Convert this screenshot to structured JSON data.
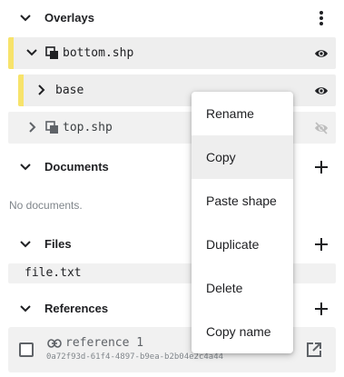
{
  "sections": {
    "overlays": {
      "title": "Overlays"
    },
    "documents": {
      "title": "Documents",
      "empty": "No documents."
    },
    "files": {
      "title": "Files"
    },
    "references": {
      "title": "References"
    }
  },
  "overlays": [
    {
      "label": "bottom.shp",
      "expanded": true,
      "visible": true
    },
    {
      "label": "base",
      "expanded": false,
      "visible": true
    },
    {
      "label": "top.shp",
      "expanded": false,
      "visible": false
    }
  ],
  "files": [
    {
      "label": "file.txt"
    }
  ],
  "references": [
    {
      "name": "reference 1",
      "id": "0a72f93d-61f4-4897-b9ea-b2b04e2c4a44",
      "checked": false
    }
  ],
  "context_menu": {
    "items": [
      "Rename",
      "Copy",
      "Paste shape",
      "Duplicate",
      "Delete",
      "Copy name"
    ],
    "highlighted": "Copy"
  },
  "colors": {
    "layer_marker": "#f7e36b",
    "row_background": "#eeeeee",
    "icon": "#202124",
    "icon_disabled": "#bdbdbd"
  },
  "icons": {
    "collapse": "chevron-down-icon",
    "expand": "chevron-right-icon",
    "more": "more-vert-icon",
    "add": "plus-icon",
    "layer": "layers-icon",
    "visibility": "eye-icon",
    "link": "link-icon",
    "open": "open-in-new-icon"
  }
}
